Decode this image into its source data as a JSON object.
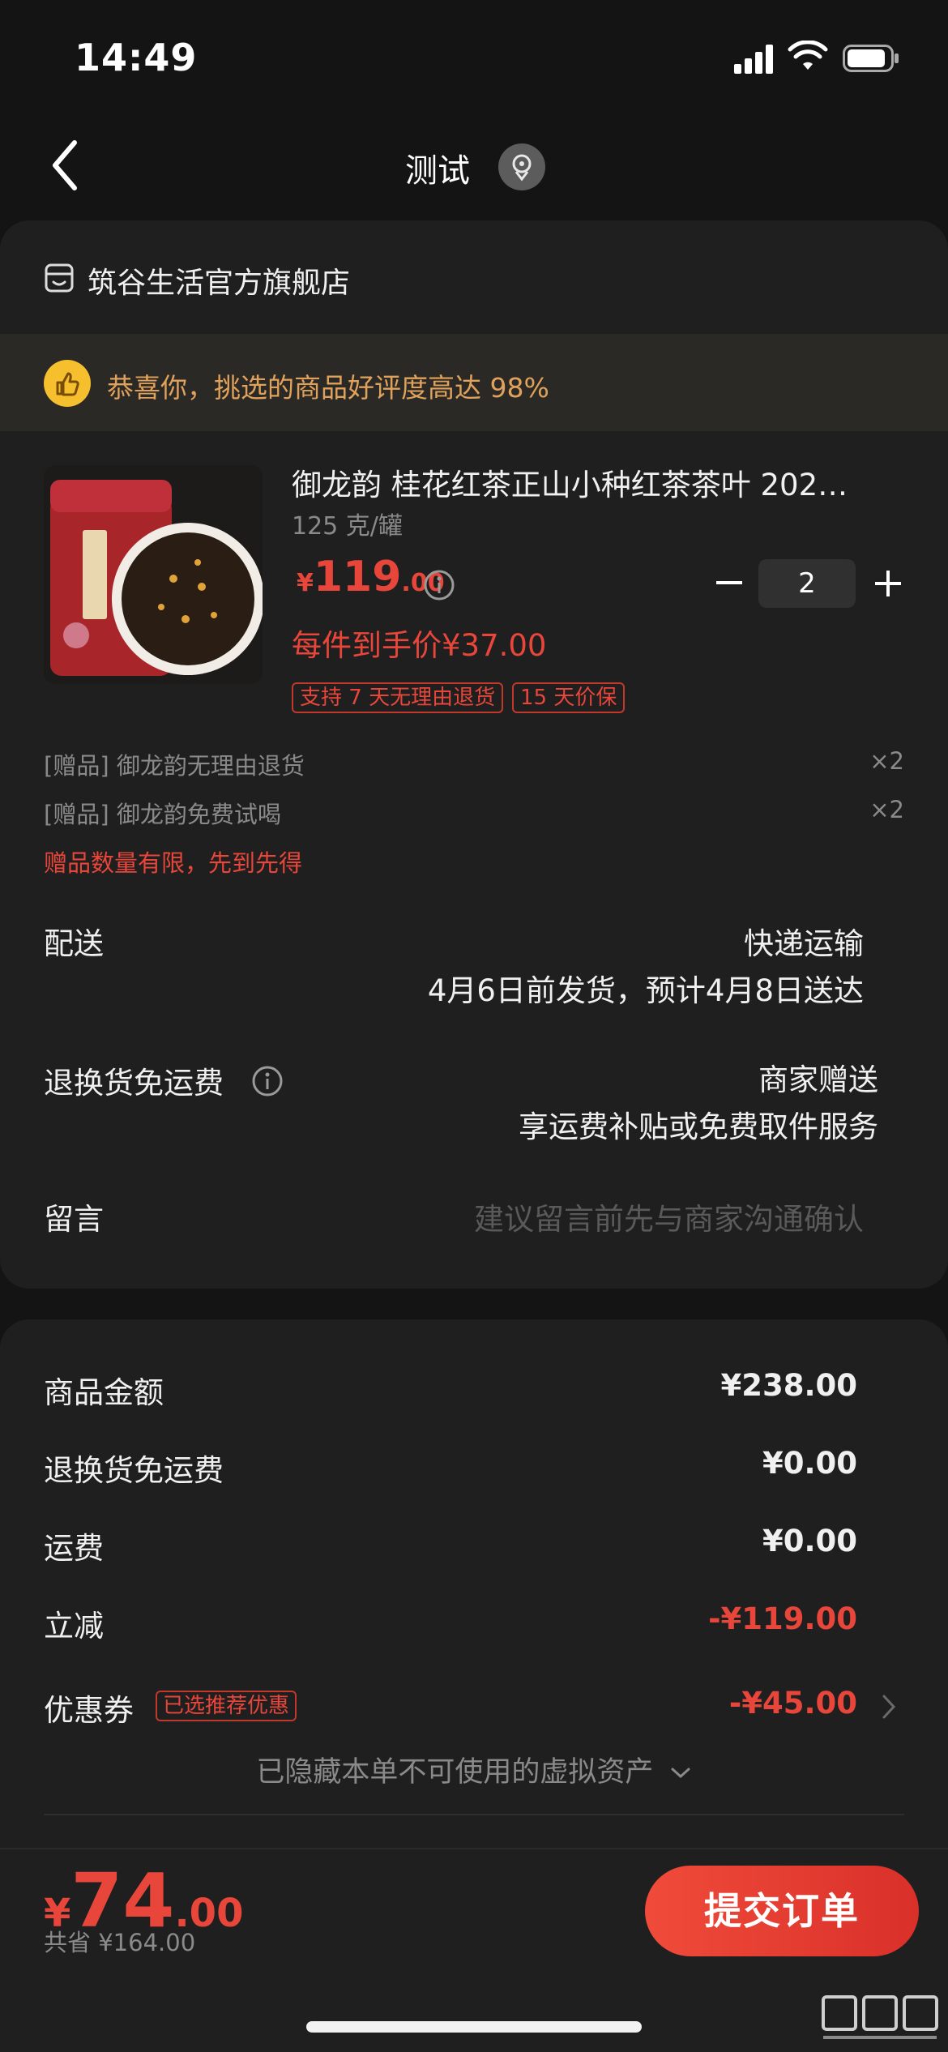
{
  "status_bar": {
    "time": "14:49"
  },
  "nav": {
    "title": "测试"
  },
  "shop": {
    "name": "筑谷生活官方旗舰店"
  },
  "banner": {
    "text": "恭喜你，挑选的商品好评度高达 98%"
  },
  "product": {
    "title": "御龙韵 桂花红茶正山小种红茶茶叶 202…",
    "spec": "125 克/罐",
    "price_currency": "¥",
    "price_int": "119",
    "price_dec": ".00",
    "quantity": "2",
    "promo_price": "每件到手价¥37.00",
    "tags": [
      "支持 7 天无理由退货",
      "15 天价保"
    ]
  },
  "gifts": [
    {
      "label": "[赠品] 御龙韵无理由退货",
      "qty": "×2"
    },
    {
      "label": "[赠品] 御龙韵免费试喝",
      "qty": "×2"
    }
  ],
  "gift_note": "赠品数量有限，先到先得",
  "delivery": {
    "label": "配送",
    "method": "快递运输",
    "eta": "4月6日前发货，预计4月8日送达"
  },
  "return_shipping": {
    "label": "退换货免运费",
    "value": "商家赠送",
    "detail": "享运费补贴或免费取件服务"
  },
  "message": {
    "label": "留言",
    "placeholder": "建议留言前先与商家沟通确认"
  },
  "summary": {
    "goods_amount_label": "商品金额",
    "goods_amount": "¥238.00",
    "return_fee_label": "退换货免运费",
    "return_fee": "¥0.00",
    "shipping_label": "运费",
    "shipping": "¥0.00",
    "discount_label": "立减",
    "discount": "-¥119.00",
    "coupon_label": "优惠券",
    "coupon_tag": "已选推荐优惠",
    "coupon": "-¥45.00",
    "hidden_note": "已隐藏本单不可使用的虚拟资产"
  },
  "bottom": {
    "currency": "¥",
    "total_int": "74",
    "total_dec": ".00",
    "saved": "共省 ¥164.00",
    "submit": "提交订单"
  },
  "colors": {
    "accent": "#e8463a",
    "background": "#141414",
    "card": "#1f1f1f",
    "banner_text": "#e0a25b"
  }
}
